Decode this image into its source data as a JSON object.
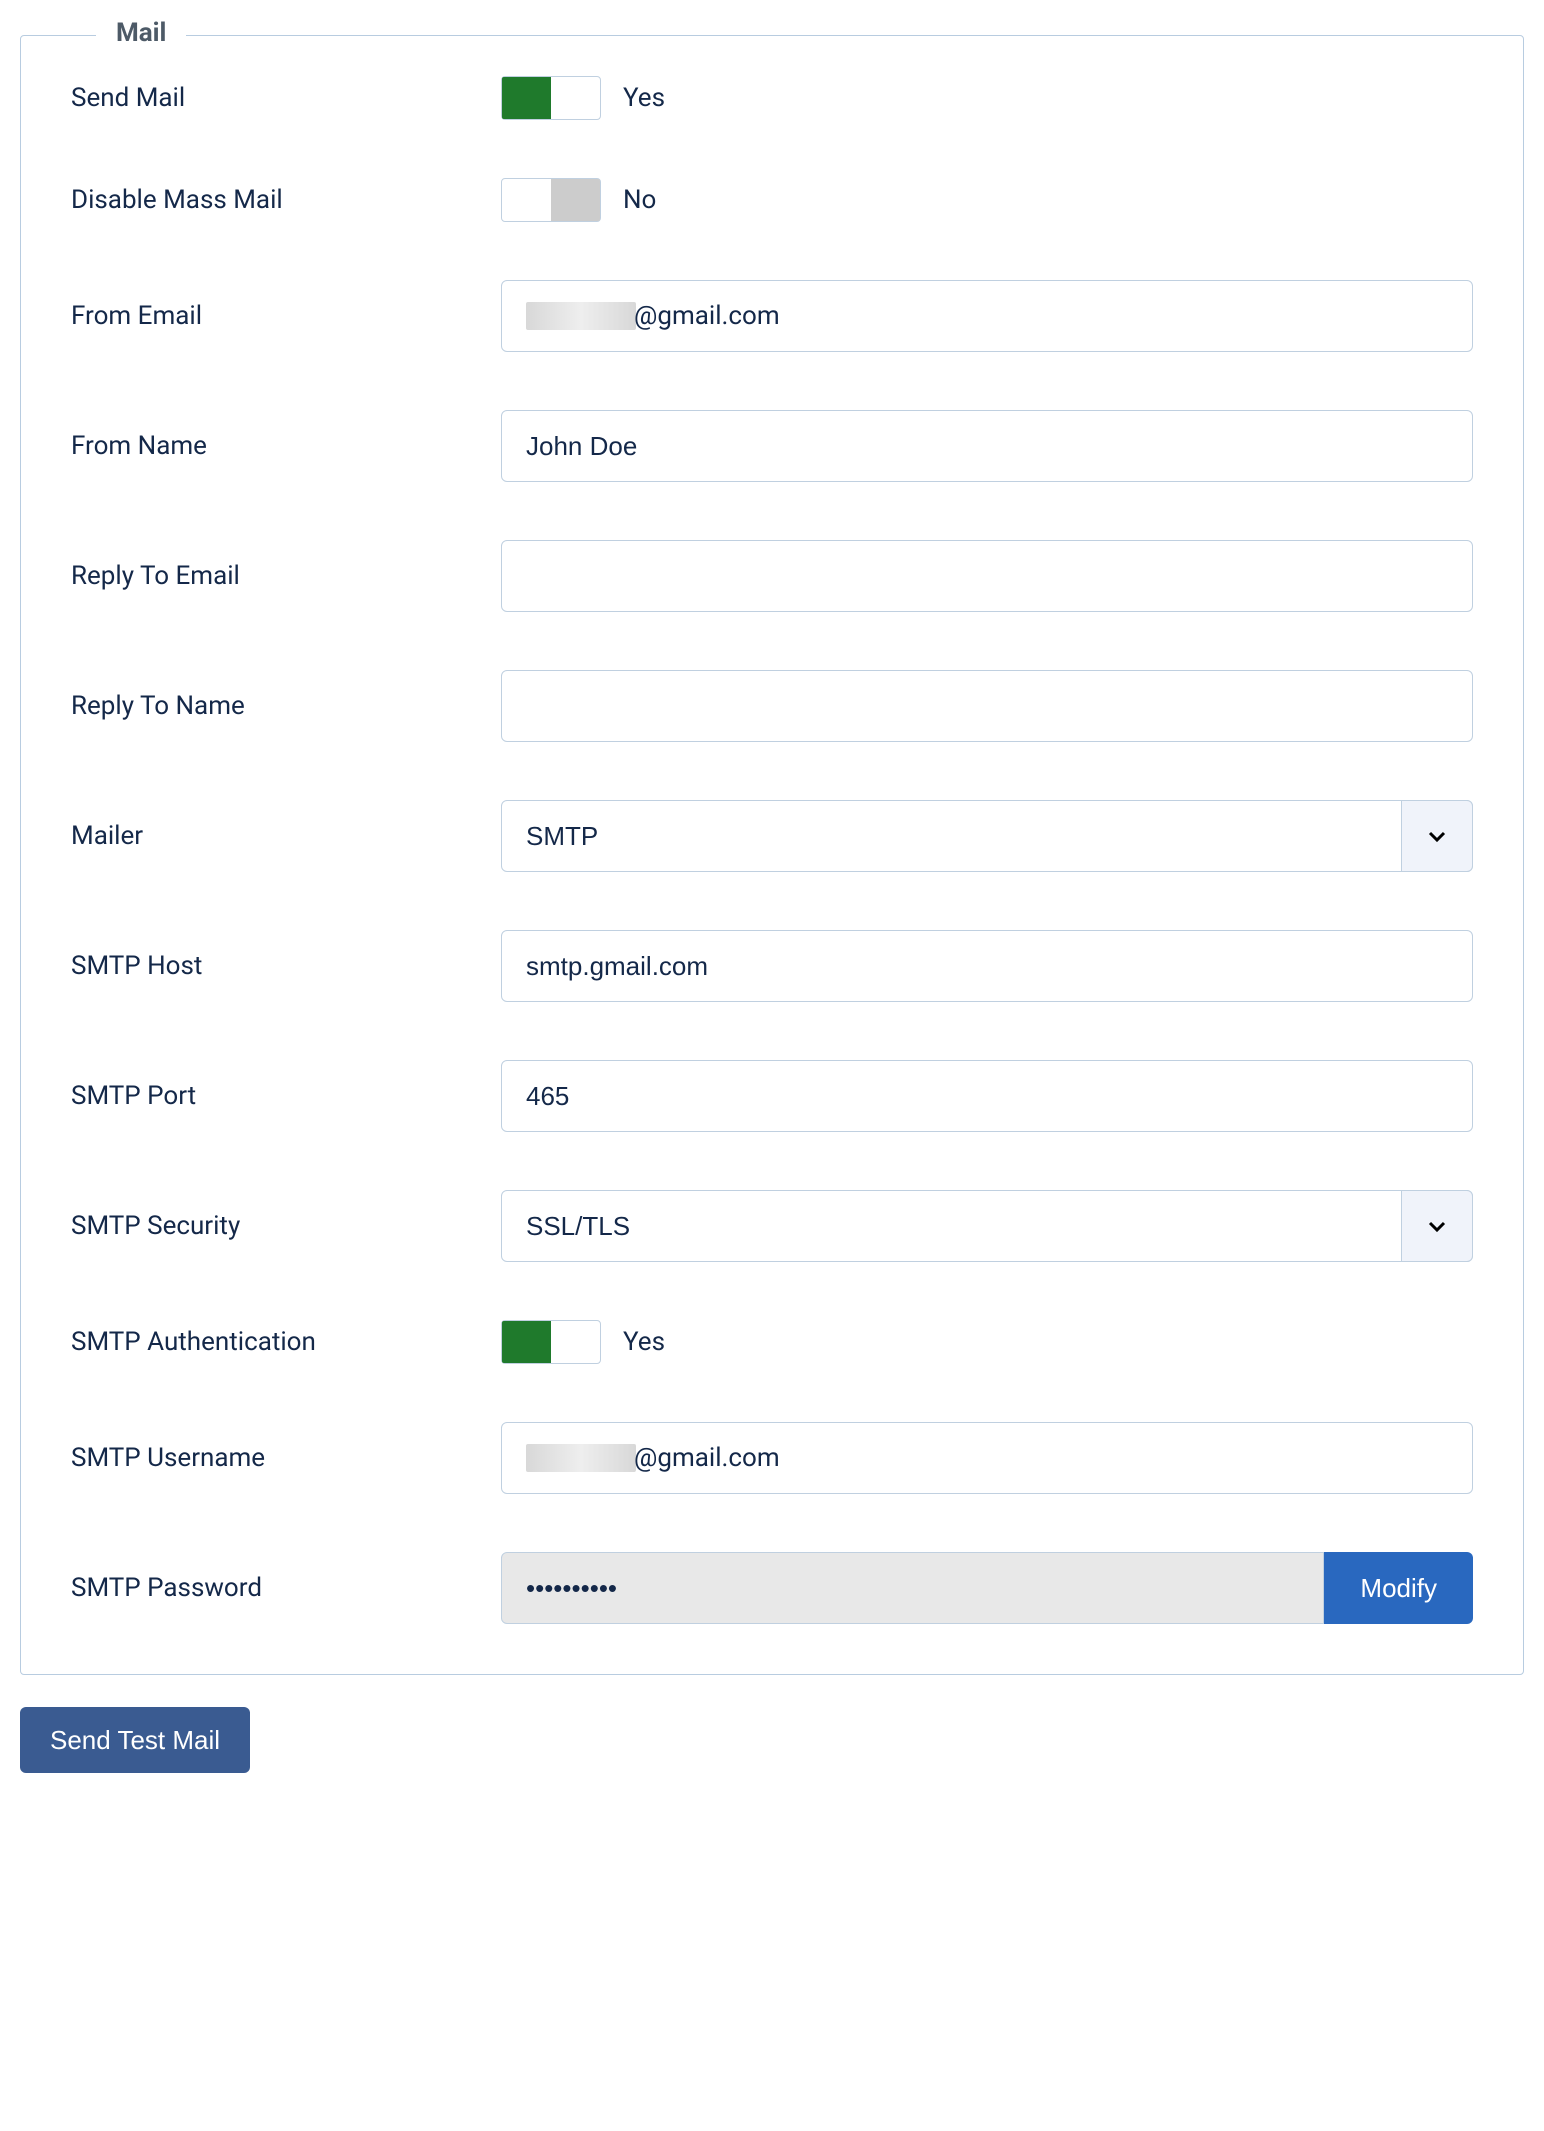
{
  "fieldset": {
    "legend": "Mail"
  },
  "sendMail": {
    "label": "Send Mail",
    "on": true,
    "value": "Yes"
  },
  "disableMassMail": {
    "label": "Disable Mass Mail",
    "on": false,
    "value": "No"
  },
  "fromEmail": {
    "label": "From Email",
    "suffix": "@gmail.com"
  },
  "fromName": {
    "label": "From Name",
    "value": "John Doe"
  },
  "replyToEmail": {
    "label": "Reply To Email",
    "value": ""
  },
  "replyToName": {
    "label": "Reply To Name",
    "value": ""
  },
  "mailer": {
    "label": "Mailer",
    "value": "SMTP"
  },
  "smtpHost": {
    "label": "SMTP Host",
    "value": "smtp.gmail.com"
  },
  "smtpPort": {
    "label": "SMTP Port",
    "value": "465"
  },
  "smtpSecurity": {
    "label": "SMTP Security",
    "value": "SSL/TLS"
  },
  "smtpAuth": {
    "label": "SMTP Authentication",
    "on": true,
    "value": "Yes"
  },
  "smtpUsername": {
    "label": "SMTP Username",
    "suffix": "@gmail.com"
  },
  "smtpPassword": {
    "label": "SMTP Password",
    "value": "••••••••••",
    "modifyLabel": "Modify"
  },
  "sendTestMail": {
    "label": "Send Test Mail"
  }
}
